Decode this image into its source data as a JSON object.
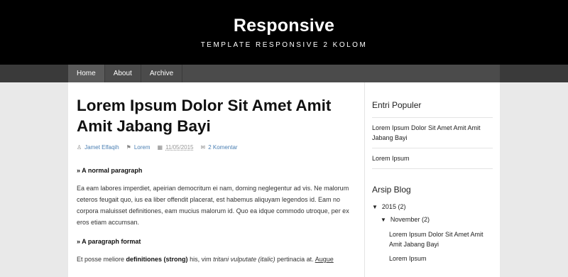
{
  "header": {
    "title": "Responsive",
    "description": "TEMPLATE RESPONSIVE 2 KOLOM"
  },
  "nav": {
    "items": [
      {
        "label": "Home"
      },
      {
        "label": "About"
      },
      {
        "label": "Archive"
      }
    ]
  },
  "post": {
    "title": "Lorem Ipsum Dolor Sit Amet Amit Amit Jabang Bayi",
    "author": "Jamet Elfaqih",
    "label": "Lorem",
    "date": "11/05/2015",
    "comments": "2 Komentar",
    "icons": {
      "author": "user-icon",
      "label": "tag-icon",
      "date": "calendar-icon",
      "comments": "comments-icon"
    },
    "section1_heading": "» A normal paragraph",
    "section1_body": "Ea eam labores imperdiet, apeirian democritum ei nam, doming neglegentur ad vis. Ne malorum ceteros feugait quo, ius ea liber offendit placerat, est habemus aliquyam legendos id. Eam no corpora maluisset definitiones, eam mucius malorum id. Quo ea idque commodo utroque, per ex eros etiam accumsan.",
    "section2_heading": "» A paragraph format",
    "section2_start": "Et posse meliore",
    "section2_bold": "definitiones (strong)",
    "section2_mid": "his, vim",
    "section2_italic": "tritani vulputate (italic)",
    "section2_end": "pertinacia at.",
    "section2_link": "Augue"
  },
  "sidebar": {
    "popular_title": "Entri Populer",
    "popular_items": [
      {
        "label": "Lorem Ipsum Dolor Sit Amet Amit Amit Jabang Bayi"
      },
      {
        "label": "Lorem Ipsum"
      }
    ],
    "archive_title": "Arsip Blog",
    "archive": {
      "year": "2015",
      "year_count": "(2)",
      "month": "November",
      "month_count": "(2)",
      "posts": [
        {
          "label": "Lorem Ipsum Dolor Sit Amet Amit Amit Jabang Bayi"
        },
        {
          "label": "Lorem Ipsum"
        }
      ],
      "toggle_icon": "triangle-down-icon"
    }
  }
}
